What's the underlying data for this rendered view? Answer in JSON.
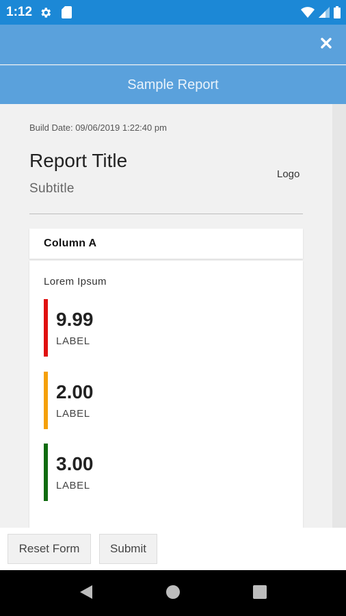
{
  "status_bar": {
    "time": "1:12",
    "icons": [
      "gear-icon",
      "sd-card-icon",
      "wifi-icon",
      "signal-icon",
      "battery-icon"
    ]
  },
  "app_bar": {
    "close_icon": "close-icon"
  },
  "title_bar": {
    "title": "Sample Report"
  },
  "report": {
    "build_date": "Build Date: 09/06/2019 1:22:40 pm",
    "title": "Report Title",
    "subtitle": "Subtitle",
    "logo": "Logo"
  },
  "card": {
    "header": "Column A",
    "section_label": "Lorem Ipsum",
    "metrics": [
      {
        "value": "9.99",
        "label": "LABEL",
        "color": "#e01010"
      },
      {
        "value": "2.00",
        "label": "LABEL",
        "color": "#f5a00a"
      },
      {
        "value": "3.00",
        "label": "LABEL",
        "color": "#0f6b0f"
      }
    ]
  },
  "footer": {
    "reset_label": "Reset Form",
    "submit_label": "Submit"
  },
  "nav_bar": {
    "icons": [
      "back-icon",
      "home-icon",
      "recents-icon"
    ]
  },
  "colors": {
    "status_bar": "#1c88d6",
    "app_bar": "#5aa1dc",
    "background": "#f1f1f1"
  }
}
